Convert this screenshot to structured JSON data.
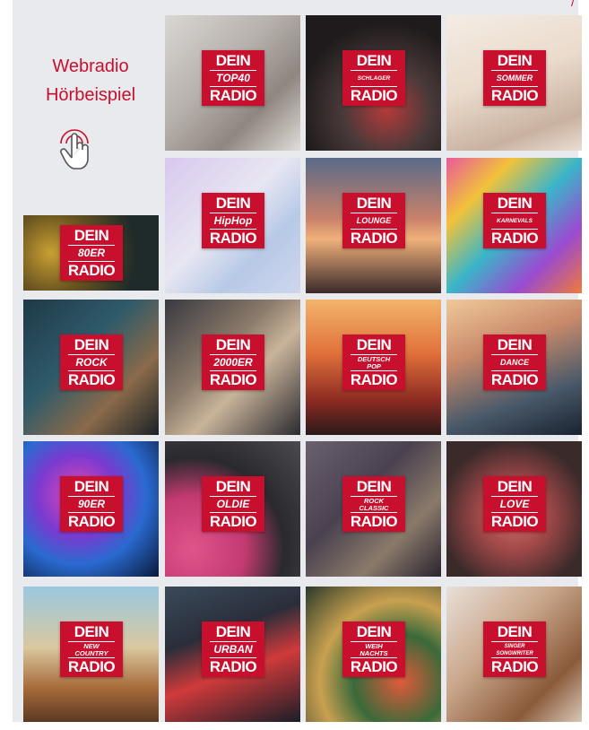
{
  "intro": {
    "line1": "Webradio",
    "line2": "Hörbeispiel",
    "icon": "touch-hand-icon"
  },
  "corner_mark": "/",
  "colors": {
    "brand_red": "#c8102e",
    "panel_bg": "#e9eaee"
  },
  "logo": {
    "top": "DEIN",
    "bottom": "RADIO"
  },
  "stations": [
    {
      "id": "top40",
      "genre": "TOP40"
    },
    {
      "id": "schlager",
      "genre": "SCHLAGER"
    },
    {
      "id": "sommer",
      "genre": "SOMMER"
    },
    {
      "id": "80er",
      "genre": "80ER"
    },
    {
      "id": "hiphop",
      "genre": "HipHop"
    },
    {
      "id": "lounge",
      "genre": "LOUNGE"
    },
    {
      "id": "karnevals",
      "genre": "KARNEVALS"
    },
    {
      "id": "rock",
      "genre": "ROCK"
    },
    {
      "id": "2000er",
      "genre": "2000ER"
    },
    {
      "id": "deutschpop",
      "genre": "DEUTSCH POP"
    },
    {
      "id": "dance",
      "genre": "DANCE"
    },
    {
      "id": "90er",
      "genre": "90ER"
    },
    {
      "id": "oldie",
      "genre": "OLDIE"
    },
    {
      "id": "rockclassic",
      "genre": "ROCK CLASSIC"
    },
    {
      "id": "love",
      "genre": "LOVE"
    },
    {
      "id": "newcountry",
      "genre": "NEW COUNTRY"
    },
    {
      "id": "urban",
      "genre": "URBAN"
    },
    {
      "id": "weihnachts",
      "genre": "WEIH NACHTS"
    },
    {
      "id": "singersongwriter",
      "genre": "SINGER SONGWRITER"
    }
  ]
}
